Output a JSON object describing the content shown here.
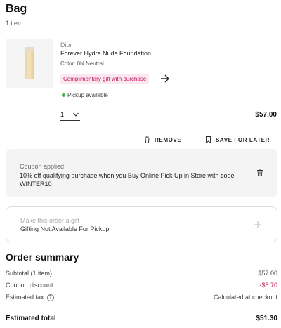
{
  "bag": {
    "title": "Bag",
    "item_count": "1 item"
  },
  "item": {
    "brand": "Dior",
    "name": "Forever Hydra Nude Foundation",
    "color": "Color: 0N Neutral",
    "gift_badge": "Complimentary gift with purchase",
    "pickup": "Pickup available",
    "quantity": "1",
    "price": "$57.00",
    "remove_label": "REMOVE",
    "save_label": "SAVE FOR LATER"
  },
  "coupon": {
    "label": "Coupon applied",
    "description": "10% off qualifying purchase when you Buy Online Pick Up in Store with code WINTER10"
  },
  "gift": {
    "label": "Make this order a gift",
    "subtext": "Gifting Not Available For Pickup"
  },
  "summary": {
    "title": "Order summary",
    "subtotal_label": "Subtotal (1 item)",
    "subtotal_value": "$57.00",
    "coupon_label": "Coupon discount",
    "coupon_value": "-$5.70",
    "tax_label": "Estimated tax",
    "tax_value": "Calculated at checkout",
    "total_label": "Estimated total",
    "total_value": "$51.30"
  },
  "colors": {
    "accent_pink": "#c2185b",
    "pill_bg": "#fbe7f0",
    "pickup_green": "#3bb54a"
  },
  "icons": {
    "arrow": "arrow-right-icon",
    "chevron": "chevron-down-icon",
    "trash": "trash-icon",
    "bookmark": "bookmark-icon",
    "plus": "plus-icon",
    "info": "info-icon"
  }
}
